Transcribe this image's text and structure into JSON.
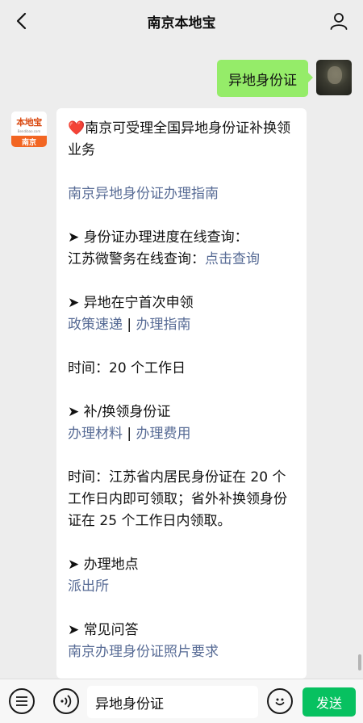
{
  "header": {
    "title": "南京本地宝"
  },
  "outgoing": {
    "text": "异地身份证"
  },
  "bot_avatar": {
    "logo_text": "本地宝",
    "logo_url": "Bendibao.com",
    "city": "南京"
  },
  "reply": {
    "intro_icon": "❤️",
    "intro": "南京可受理全国异地身份证补换领业务",
    "guide_link": "南京异地身份证办理指南",
    "progress_heading": "➤ 身份证办理进度在线查询：",
    "progress_label": "江苏微警务在线查询：",
    "progress_link": "点击查询",
    "first_heading": "➤ 异地在宁首次申领",
    "first_link_1": "政策速递",
    "separator": " | ",
    "first_link_2": "办理指南",
    "first_time": "时间：20 个工作日",
    "replace_heading": "➤ 补/换领身份证",
    "replace_link_1": "办理材料",
    "replace_link_2": "办理费用",
    "replace_time": "时间：江苏省内居民身份证在 20 个工作日内即可领取；省外补换领身份证在 25 个工作日内领取。",
    "location_heading": "➤ 办理地点",
    "location_link": "派出所",
    "faq_heading": "➤ 常见问答",
    "faq_link": "南京办理身份证照片要求"
  },
  "input": {
    "value": "异地身份证"
  },
  "actions": {
    "send_label": "发送"
  },
  "icons": {
    "back": "chevron-left-icon",
    "profile": "person-icon",
    "menu": "list-icon",
    "voice": "voice-icon",
    "emoji": "smiley-icon"
  }
}
